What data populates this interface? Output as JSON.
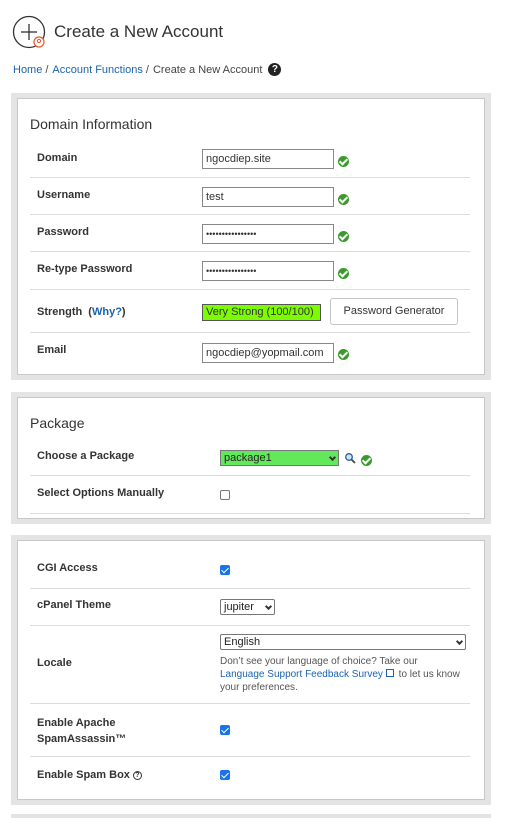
{
  "header": {
    "title": "Create a New Account"
  },
  "breadcrumb": {
    "home": "Home",
    "account_functions": "Account Functions",
    "current": "Create a New Account",
    "sep": "/"
  },
  "domain_info": {
    "title": "Domain Information",
    "domain_label": "Domain",
    "domain_value": "ngocdiep.site",
    "username_label": "Username",
    "username_value": "test",
    "password_label": "Password",
    "password_value": "••••••••••••••••",
    "retype_label": "Re-type Password",
    "retype_value": "••••••••••••••••",
    "strength_label": "Strength",
    "strength_paren_open": "(",
    "why_link": "Why?",
    "strength_paren_close": ")",
    "strength_value": "Very Strong (100/100)",
    "strength_percent": 100,
    "password_generator_label": "Password Generator",
    "email_label": "Email",
    "email_value": "ngocdiep@yopmail.com"
  },
  "package": {
    "title": "Package",
    "choose_label": "Choose a Package",
    "choose_value": "package1",
    "manual_label": "Select Options Manually",
    "manual_checked": false
  },
  "options": {
    "cgi_label": "CGI Access",
    "cgi_checked": true,
    "theme_label": "cPanel Theme",
    "theme_value": "jupiter",
    "locale_label": "Locale",
    "locale_value": "English",
    "locale_note_1": "Don’t see your language of choice? Take our",
    "locale_note_link": "Language Support Feedback Survey",
    "locale_note_2": "to let us know your preferences.",
    "spamassassin_label_1": "Enable Apache",
    "spamassassin_label_2": "SpamAssassin™",
    "spamassassin_checked": true,
    "spambox_label": "Enable Spam Box",
    "spambox_checked": true
  },
  "colors": {
    "link": "#1a63b0",
    "ok": "#3a9b2a",
    "strength": "#7cfc00",
    "package_select": "#62e85a",
    "checkbox": "#1a73e8"
  }
}
